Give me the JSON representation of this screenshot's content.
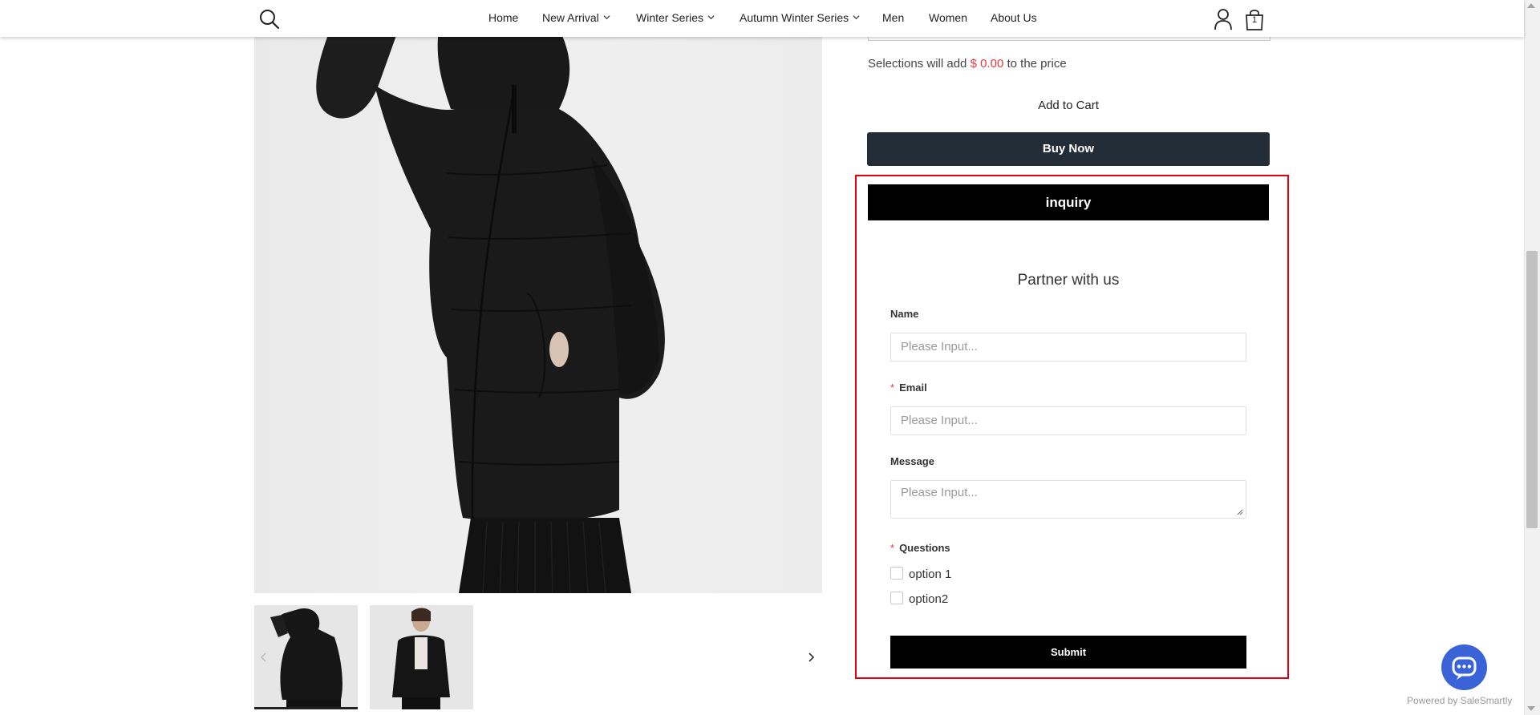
{
  "header": {
    "nav": [
      {
        "label": "Home",
        "has_dropdown": false
      },
      {
        "label": "New Arrival",
        "has_dropdown": true
      },
      {
        "label": "Winter Series",
        "has_dropdown": true
      },
      {
        "label": "Autumn Winter Series",
        "has_dropdown": true
      },
      {
        "label": "Men",
        "has_dropdown": false
      },
      {
        "label": "Women",
        "has_dropdown": false
      },
      {
        "label": "About Us",
        "has_dropdown": false
      }
    ],
    "cart_count": "1",
    "icons": [
      "search-icon",
      "account-icon",
      "cart-icon",
      "chevron-down-icon"
    ]
  },
  "product": {
    "selections_prefix": "Selections will add",
    "selections_price": "$ 0.00",
    "selections_suffix": "to the price",
    "add_to_cart_label": "Add to Cart",
    "buy_now_label": "Buy Now",
    "gallery_icons": [
      "chevron-left-icon",
      "chevron-right-icon"
    ]
  },
  "inquiry_form": {
    "bar_label": "inquiry",
    "title": "Partner with us",
    "fields": {
      "name": {
        "label": "Name",
        "placeholder": "Please Input...",
        "required": false
      },
      "email": {
        "label": "Email",
        "placeholder": "Please Input...",
        "required": true
      },
      "message": {
        "label": "Message",
        "placeholder": "Please Input...",
        "required": false
      }
    },
    "questions": {
      "label": "Questions",
      "required": true,
      "options": [
        "option 1",
        "option2"
      ]
    },
    "required_mark": "*",
    "submit_label": "Submit"
  },
  "chat_widget": {
    "powered_by": "Powered by SaleSmartly"
  },
  "colors": {
    "buy_now_bg": "#232d38",
    "price_red": "#e4393c",
    "highlight_frame": "#e60012",
    "chat_blue": "#3b63d8"
  }
}
